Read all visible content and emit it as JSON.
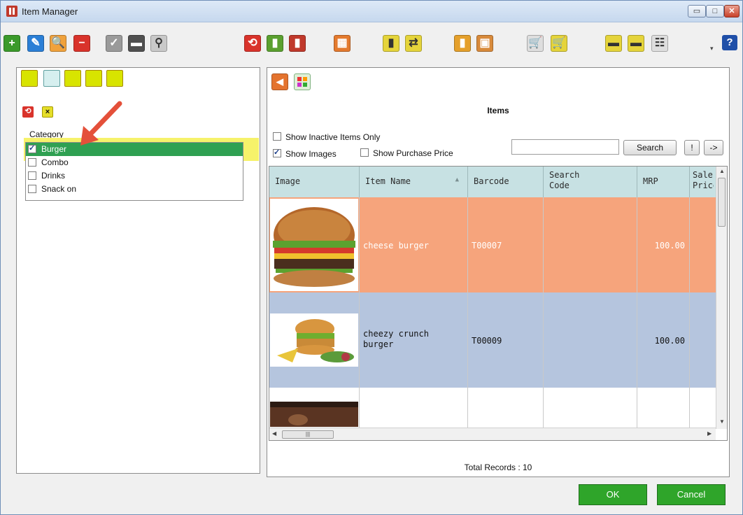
{
  "window": {
    "title": "Item Manager",
    "min_label": "▭",
    "max_label": "□",
    "close_label": "✕"
  },
  "toolbar": {
    "buttons": [
      {
        "name": "add-icon",
        "color": "#3b9a2a",
        "glyph": "+"
      },
      {
        "name": "edit-icon",
        "color": "#2b7fd6",
        "glyph": "✎"
      },
      {
        "name": "search-icon",
        "color": "#f0a23c",
        "glyph": "🔍"
      },
      {
        "name": "delete-icon",
        "color": "#d9332b",
        "glyph": "−"
      },
      {
        "name": "approve-icon",
        "color": "#9a9a9a",
        "glyph": "✓"
      },
      {
        "name": "price-tag-icon",
        "color": "#505050",
        "glyph": "▬"
      },
      {
        "name": "hierarchy-icon",
        "color": "#c9c9c9",
        "glyph": "⚲"
      },
      {
        "name": "refresh-icon",
        "color": "#d9332b",
        "glyph": "⟲"
      },
      {
        "name": "report-icon",
        "color": "#5aa02f",
        "glyph": "▮"
      },
      {
        "name": "bar-chart-icon",
        "color": "#c0392b",
        "glyph": "▮"
      },
      {
        "name": "table-export-icon",
        "color": "#e47a2e",
        "glyph": "▦"
      },
      {
        "name": "stock-icon",
        "color": "#e5d43b",
        "glyph": "▮"
      },
      {
        "name": "transfer-icon",
        "color": "#e5d43b",
        "glyph": "⇄"
      },
      {
        "name": "category-chart-icon",
        "color": "#e5a02b",
        "glyph": "▮"
      },
      {
        "name": "box-icon",
        "color": "#d88a3b",
        "glyph": "▣"
      },
      {
        "name": "cart-icon",
        "color": "#dedede",
        "glyph": "🛒"
      },
      {
        "name": "cart-add-icon",
        "color": "#e5d43b",
        "glyph": "🛒"
      },
      {
        "name": "truck-icon",
        "color": "#e5d43b",
        "glyph": "▬"
      },
      {
        "name": "delivery-icon",
        "color": "#e5d43b",
        "glyph": "▬"
      },
      {
        "name": "checklist-icon",
        "color": "#dedede",
        "glyph": "☷"
      }
    ],
    "help": "?"
  },
  "left": {
    "refresh_glyph": "⟲",
    "clear_glyph": "×",
    "category_label": "Category",
    "categories": [
      {
        "label": "Burger",
        "checked": true
      },
      {
        "label": "Combo",
        "checked": false
      },
      {
        "label": "Drinks",
        "checked": false
      },
      {
        "label": "Snack on",
        "checked": false
      }
    ]
  },
  "main": {
    "title": "Items",
    "show_inactive": "Show Inactive Items Only",
    "show_images": "Show Images",
    "show_purchase": "Show Purchase Price",
    "search_button": "Search",
    "excl_button": "!",
    "arrow_button": "->",
    "columns": [
      "Image",
      "Item Name",
      "Barcode",
      "Search Code",
      "MRP",
      "Sale Price"
    ],
    "rows": [
      {
        "name": "cheese burger",
        "barcode": "T00007",
        "search_code": "",
        "mrp": "100.00"
      },
      {
        "name": "cheezy crunch burger",
        "barcode": "T00009",
        "search_code": "",
        "mrp": "100.00"
      }
    ],
    "total_records": "Total Records : 10"
  },
  "footer": {
    "ok": "OK",
    "cancel": "Cancel"
  },
  "colors": {
    "row_orange": "#f6a47c",
    "row_blue": "#b5c5de",
    "header_teal": "#c7e1e3",
    "selected_green": "#2fa052"
  }
}
